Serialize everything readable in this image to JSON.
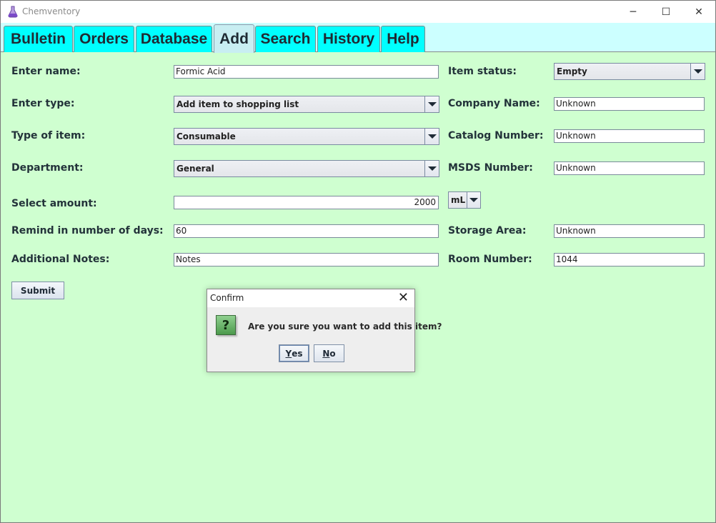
{
  "window": {
    "title": "Chemventory",
    "minimize_glyph": "─",
    "maximize_glyph": "☐",
    "close_glyph": "✕"
  },
  "tabs": [
    {
      "label": "Bulletin"
    },
    {
      "label": "Orders"
    },
    {
      "label": "Database"
    },
    {
      "label": "Add",
      "active": true
    },
    {
      "label": "Search"
    },
    {
      "label": "History"
    },
    {
      "label": "Help"
    }
  ],
  "form": {
    "name_label": "Enter name:",
    "name_value": "Formic Acid",
    "type_label": "Enter type:",
    "type_value": "Add item to shopping list",
    "item_type_label": "Type of item:",
    "item_type_value": "Consumable",
    "department_label": "Department:",
    "department_value": "General",
    "amount_label": "Select amount:",
    "amount_value": "2000",
    "unit_value": "mL",
    "remind_label": "Remind in number of days:",
    "remind_value": "60",
    "notes_label": "Additional Notes:",
    "notes_value": "Notes",
    "status_label": "Item status:",
    "status_value": "Empty",
    "company_label": "Company Name:",
    "company_value": "Unknown",
    "catalog_label": "Catalog Number:",
    "catalog_value": "Unknown",
    "msds_label": "MSDS Number:",
    "msds_value": "Unknown",
    "storage_label": "Storage Area:",
    "storage_value": "Unknown",
    "room_label": "Room Number:",
    "room_value": "1044",
    "submit_label": "Submit"
  },
  "dialog": {
    "title": "Confirm",
    "close_glyph": "✕",
    "icon_glyph": "?",
    "message": "Are you sure you want to add this item?",
    "yes_mnemonic": "Y",
    "yes_rest": "es",
    "no_mnemonic": "N",
    "no_rest": "o"
  },
  "colors": {
    "background": "#cfffd0",
    "tab": "#00ffff",
    "tab_active": "#c8eef2",
    "tabstrip": "#ccffff"
  }
}
